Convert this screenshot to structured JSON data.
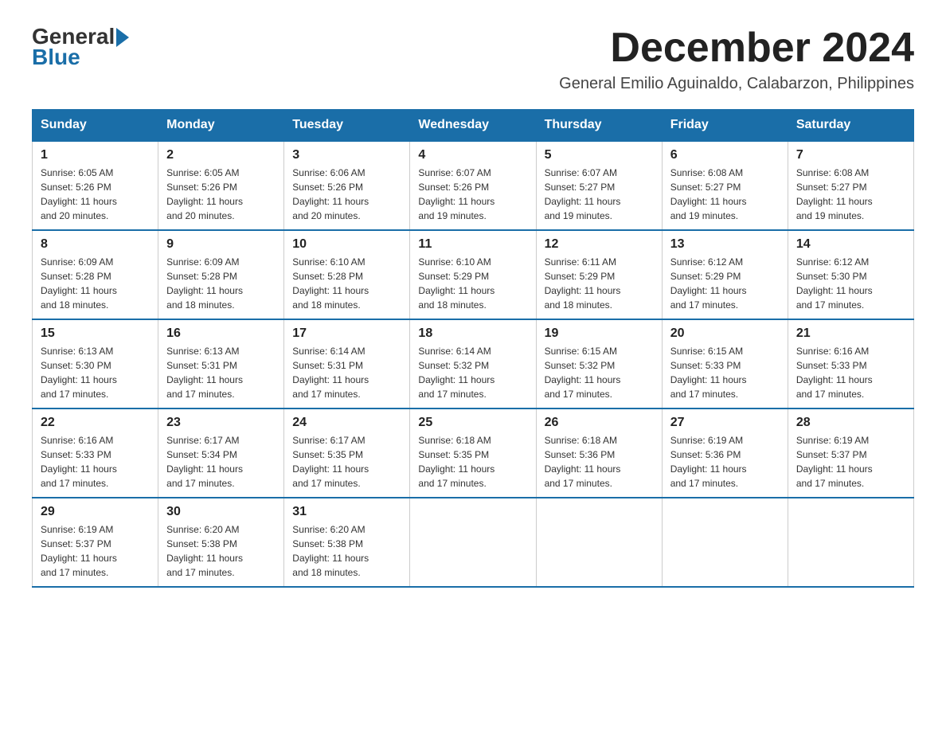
{
  "header": {
    "logo_text_general": "General",
    "logo_text_blue": "Blue",
    "month_title": "December 2024",
    "location": "General Emilio Aguinaldo, Calabarzon, Philippines"
  },
  "weekdays": [
    "Sunday",
    "Monday",
    "Tuesday",
    "Wednesday",
    "Thursday",
    "Friday",
    "Saturday"
  ],
  "weeks": [
    [
      {
        "day": "1",
        "sunrise": "6:05 AM",
        "sunset": "5:26 PM",
        "daylight": "11 hours and 20 minutes."
      },
      {
        "day": "2",
        "sunrise": "6:05 AM",
        "sunset": "5:26 PM",
        "daylight": "11 hours and 20 minutes."
      },
      {
        "day": "3",
        "sunrise": "6:06 AM",
        "sunset": "5:26 PM",
        "daylight": "11 hours and 20 minutes."
      },
      {
        "day": "4",
        "sunrise": "6:07 AM",
        "sunset": "5:26 PM",
        "daylight": "11 hours and 19 minutes."
      },
      {
        "day": "5",
        "sunrise": "6:07 AM",
        "sunset": "5:27 PM",
        "daylight": "11 hours and 19 minutes."
      },
      {
        "day": "6",
        "sunrise": "6:08 AM",
        "sunset": "5:27 PM",
        "daylight": "11 hours and 19 minutes."
      },
      {
        "day": "7",
        "sunrise": "6:08 AM",
        "sunset": "5:27 PM",
        "daylight": "11 hours and 19 minutes."
      }
    ],
    [
      {
        "day": "8",
        "sunrise": "6:09 AM",
        "sunset": "5:28 PM",
        "daylight": "11 hours and 18 minutes."
      },
      {
        "day": "9",
        "sunrise": "6:09 AM",
        "sunset": "5:28 PM",
        "daylight": "11 hours and 18 minutes."
      },
      {
        "day": "10",
        "sunrise": "6:10 AM",
        "sunset": "5:28 PM",
        "daylight": "11 hours and 18 minutes."
      },
      {
        "day": "11",
        "sunrise": "6:10 AM",
        "sunset": "5:29 PM",
        "daylight": "11 hours and 18 minutes."
      },
      {
        "day": "12",
        "sunrise": "6:11 AM",
        "sunset": "5:29 PM",
        "daylight": "11 hours and 18 minutes."
      },
      {
        "day": "13",
        "sunrise": "6:12 AM",
        "sunset": "5:29 PM",
        "daylight": "11 hours and 17 minutes."
      },
      {
        "day": "14",
        "sunrise": "6:12 AM",
        "sunset": "5:30 PM",
        "daylight": "11 hours and 17 minutes."
      }
    ],
    [
      {
        "day": "15",
        "sunrise": "6:13 AM",
        "sunset": "5:30 PM",
        "daylight": "11 hours and 17 minutes."
      },
      {
        "day": "16",
        "sunrise": "6:13 AM",
        "sunset": "5:31 PM",
        "daylight": "11 hours and 17 minutes."
      },
      {
        "day": "17",
        "sunrise": "6:14 AM",
        "sunset": "5:31 PM",
        "daylight": "11 hours and 17 minutes."
      },
      {
        "day": "18",
        "sunrise": "6:14 AM",
        "sunset": "5:32 PM",
        "daylight": "11 hours and 17 minutes."
      },
      {
        "day": "19",
        "sunrise": "6:15 AM",
        "sunset": "5:32 PM",
        "daylight": "11 hours and 17 minutes."
      },
      {
        "day": "20",
        "sunrise": "6:15 AM",
        "sunset": "5:33 PM",
        "daylight": "11 hours and 17 minutes."
      },
      {
        "day": "21",
        "sunrise": "6:16 AM",
        "sunset": "5:33 PM",
        "daylight": "11 hours and 17 minutes."
      }
    ],
    [
      {
        "day": "22",
        "sunrise": "6:16 AM",
        "sunset": "5:33 PM",
        "daylight": "11 hours and 17 minutes."
      },
      {
        "day": "23",
        "sunrise": "6:17 AM",
        "sunset": "5:34 PM",
        "daylight": "11 hours and 17 minutes."
      },
      {
        "day": "24",
        "sunrise": "6:17 AM",
        "sunset": "5:35 PM",
        "daylight": "11 hours and 17 minutes."
      },
      {
        "day": "25",
        "sunrise": "6:18 AM",
        "sunset": "5:35 PM",
        "daylight": "11 hours and 17 minutes."
      },
      {
        "day": "26",
        "sunrise": "6:18 AM",
        "sunset": "5:36 PM",
        "daylight": "11 hours and 17 minutes."
      },
      {
        "day": "27",
        "sunrise": "6:19 AM",
        "sunset": "5:36 PM",
        "daylight": "11 hours and 17 minutes."
      },
      {
        "day": "28",
        "sunrise": "6:19 AM",
        "sunset": "5:37 PM",
        "daylight": "11 hours and 17 minutes."
      }
    ],
    [
      {
        "day": "29",
        "sunrise": "6:19 AM",
        "sunset": "5:37 PM",
        "daylight": "11 hours and 17 minutes."
      },
      {
        "day": "30",
        "sunrise": "6:20 AM",
        "sunset": "5:38 PM",
        "daylight": "11 hours and 17 minutes."
      },
      {
        "day": "31",
        "sunrise": "6:20 AM",
        "sunset": "5:38 PM",
        "daylight": "11 hours and 18 minutes."
      },
      null,
      null,
      null,
      null
    ]
  ],
  "labels": {
    "sunrise": "Sunrise:",
    "sunset": "Sunset:",
    "daylight": "Daylight:"
  }
}
